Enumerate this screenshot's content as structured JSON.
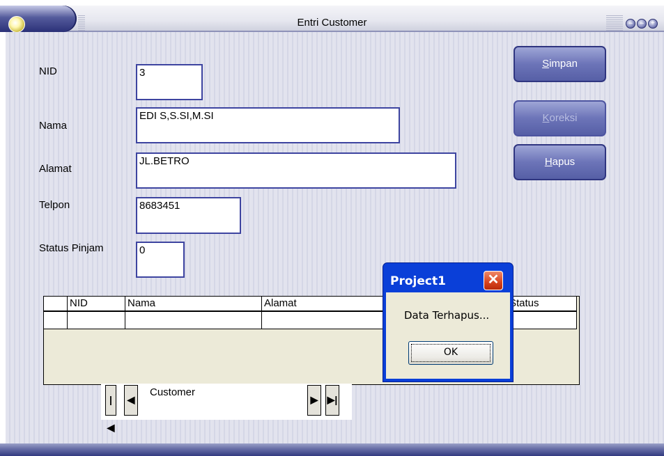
{
  "window": {
    "title": "Entri Customer",
    "title_buttons": [
      "minimize-icon",
      "restore-icon",
      "maximize-icon"
    ]
  },
  "form": {
    "nid": {
      "label": "NID",
      "value": "3"
    },
    "nama": {
      "label": "Nama",
      "value": "EDI S,S.SI,M.SI"
    },
    "alamat": {
      "label": "Alamat",
      "value": "JL.BETRO"
    },
    "telpon": {
      "label": "Telpon",
      "value": "8683451"
    },
    "status": {
      "label": "Status Pinjam",
      "value": "0"
    }
  },
  "buttons": {
    "simpan": {
      "accel": "S",
      "rest": "impan",
      "enabled": true
    },
    "koreksi": {
      "accel": "K",
      "rest": "oreksi",
      "enabled": false
    },
    "hapus": {
      "accel": "H",
      "rest": "apus",
      "enabled": true
    }
  },
  "grid": {
    "columns": [
      "NID",
      "Nama",
      "Alamat",
      "Status"
    ],
    "rows": [
      [
        "",
        "",
        "",
        ""
      ]
    ]
  },
  "navigator": {
    "caption": "Customer"
  },
  "message_box": {
    "title": "Project1",
    "text": "Data Terhapus...",
    "ok_label": "OK"
  },
  "colors": {
    "window_blue": "#545b9c",
    "dialog_title": "#0a3fd8",
    "close_red": "#d8431e",
    "field_border": "#3d44a0"
  }
}
